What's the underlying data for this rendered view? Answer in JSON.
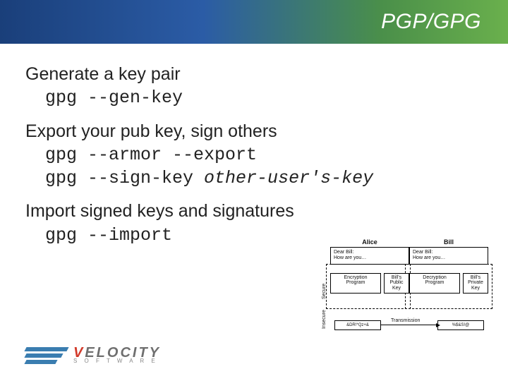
{
  "title": "PGP/GPG",
  "body": {
    "sec1": {
      "heading": "Generate a key pair",
      "cmd1": "gpg --gen-key"
    },
    "sec2": {
      "heading": "Export your pub key, sign others",
      "cmd1": "gpg --armor --export",
      "cmd2a": "gpg --sign-key ",
      "cmd2b": "other-user's-key"
    },
    "sec3": {
      "heading": "Import signed keys and signatures",
      "cmd1": "gpg --import"
    }
  },
  "diagram": {
    "left_name": "Alice",
    "right_name": "Bill",
    "msg_left_l1": "Dear Bill:",
    "msg_left_l2": "How are you…",
    "msg_right_l1": "Dear Bill:",
    "msg_right_l2": "How are you…",
    "enc_l1": "Encryption",
    "enc_l2": "Program",
    "dec_l1": "Decryption",
    "dec_l2": "Program",
    "pubkey_l1": "Bill's",
    "pubkey_l2": "Public",
    "pubkey_l3": "Key",
    "privkey_l1": "Bill's",
    "privkey_l2": "Private",
    "privkey_l3": "Key",
    "cipher_l": "&DR!*Qz+&",
    "cipher_r": "%$&S!@",
    "side_secure": "Secure",
    "side_insecure": "Insecure",
    "transmission": "Transmission"
  },
  "logo": {
    "word1": "V",
    "word2": "ELOCITY",
    "sub": "S  O  F  T  W  A  R  E"
  }
}
